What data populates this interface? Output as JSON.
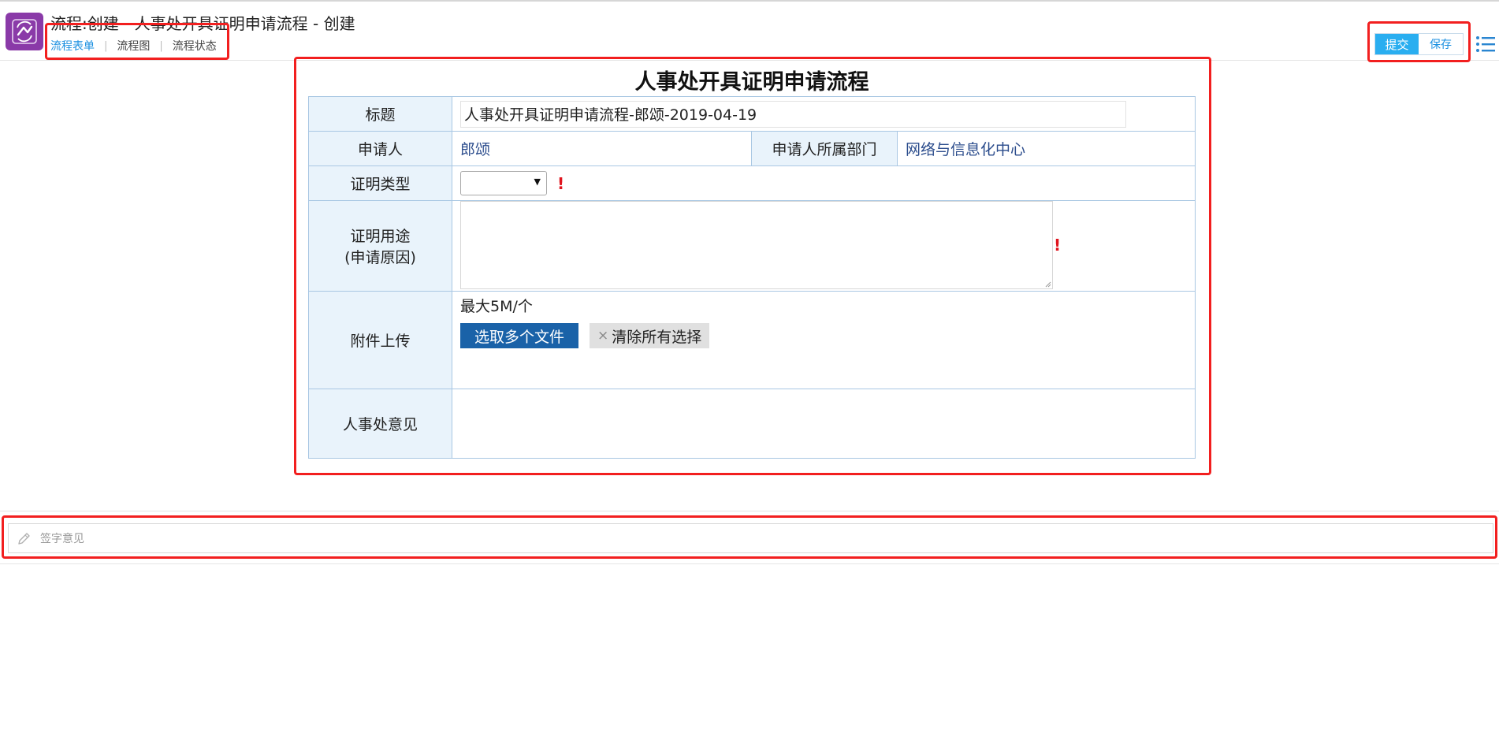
{
  "header": {
    "title": "流程:创建 - 人事处开具证明申请流程 - 创建",
    "tabs": [
      {
        "label": "流程表单",
        "active": true
      },
      {
        "label": "流程图",
        "active": false
      },
      {
        "label": "流程状态",
        "active": false
      }
    ],
    "tab_separator": "|",
    "submit_label": "提交",
    "save_label": "保存",
    "logo_icon": "workflow-icon",
    "menu_icon": "list-menu-icon",
    "brand_color": "#8a3aa8",
    "accent_color": "#29aef0"
  },
  "form": {
    "heading": "人事处开具证明申请流程",
    "title_label": "标题",
    "title_value": "人事处开具证明申请流程-郎颂-2019-04-19",
    "applicant_label": "申请人",
    "applicant_value": "郎颂",
    "department_label": "申请人所属部门",
    "department_value": "网络与信息化中心",
    "cert_type_label": "证明类型",
    "cert_type_value": "",
    "purpose_label_line1": "证明用途",
    "purpose_label_line2": "(申请原因)",
    "purpose_value": "",
    "required_mark": "!",
    "attachment_label": "附件上传",
    "attachment_max": "最大5M/个",
    "choose_files_label": "选取多个文件",
    "clear_icon": "×",
    "clear_selection_label": "清除所有选择",
    "hr_opinion_label": "人事处意见",
    "hr_opinion_value": ""
  },
  "signature": {
    "placeholder": "签字意见",
    "icon": "pencil-icon"
  }
}
